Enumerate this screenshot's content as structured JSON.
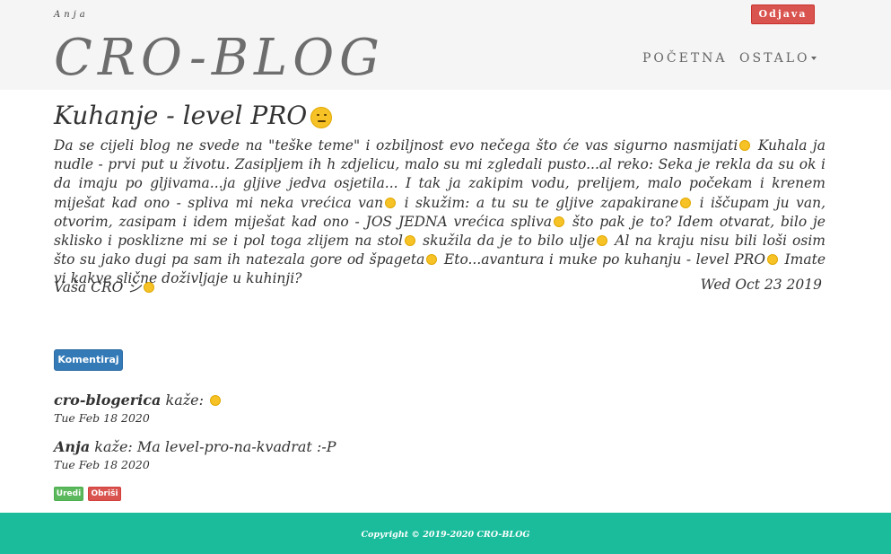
{
  "header": {
    "username": "Anja",
    "brand": "CRO-BLOG",
    "logout_label": "Odjava",
    "nav": {
      "home": "POČETNA",
      "more": "OSTALO"
    }
  },
  "post": {
    "title": "Kuhanje - level PRO",
    "body_parts": [
      "Da se cijeli blog ne svede na \"teške teme\" i ozbiljnost evo nečega što će vas sigurno nasmijati",
      "Kuhala ja nudle - prvi put u životu. Zasipljem ih h zdjelicu, malo su mi zgledali pusto...al reko: Seka je rekla da su ok i da imaju po gljivama...ja gljive jedva osjetila... I tak ja zakipim vodu, prelijem, malo počekam i krenem miješat kad ono - spliva mi neka vrećica van",
      "i skužim: a tu su te gljive zapakirane",
      "i iščupam ju van, otvorim, zasipam i idem miješat kad ono - JOS JEDNA vrećica spliva",
      "što pak je to? Idem otvarat, bilo je sklisko i posklizne mi se i pol toga zlijem na stol",
      "skužila da je to bilo ulje",
      "Al na kraju nisu bili loši osim što su jako dugi pa sam ih natezala gore od špageta",
      "Eto...avantura i muke po kuhanju - level PRO",
      "Imate vi kakve slične doživljaje u kuhinji?"
    ],
    "signature": "Vaša CRO シ",
    "date": "Wed Oct 23 2019",
    "comment_button": "Komentiraj"
  },
  "comments": [
    {
      "author": "cro-blogerica",
      "says": "kaže:",
      "text": "",
      "date": "Tue Feb 18 2020"
    },
    {
      "author": "Anja",
      "says": "kaže:",
      "text": "Ma level-pro-na-kvadrat :-P",
      "date": "Tue Feb 18 2020"
    }
  ],
  "actions": {
    "edit": "Uredi",
    "delete": "Obriši"
  },
  "footer": {
    "copyright": "Copyright © 2019-2020 CRO-BLOG"
  },
  "colors": {
    "header_bg": "#f5f5f5",
    "danger": "#d9534f",
    "primary": "#337ab7",
    "success": "#5cb85c",
    "footer_bg": "#1abc9c",
    "emoji": "#f7c226"
  }
}
